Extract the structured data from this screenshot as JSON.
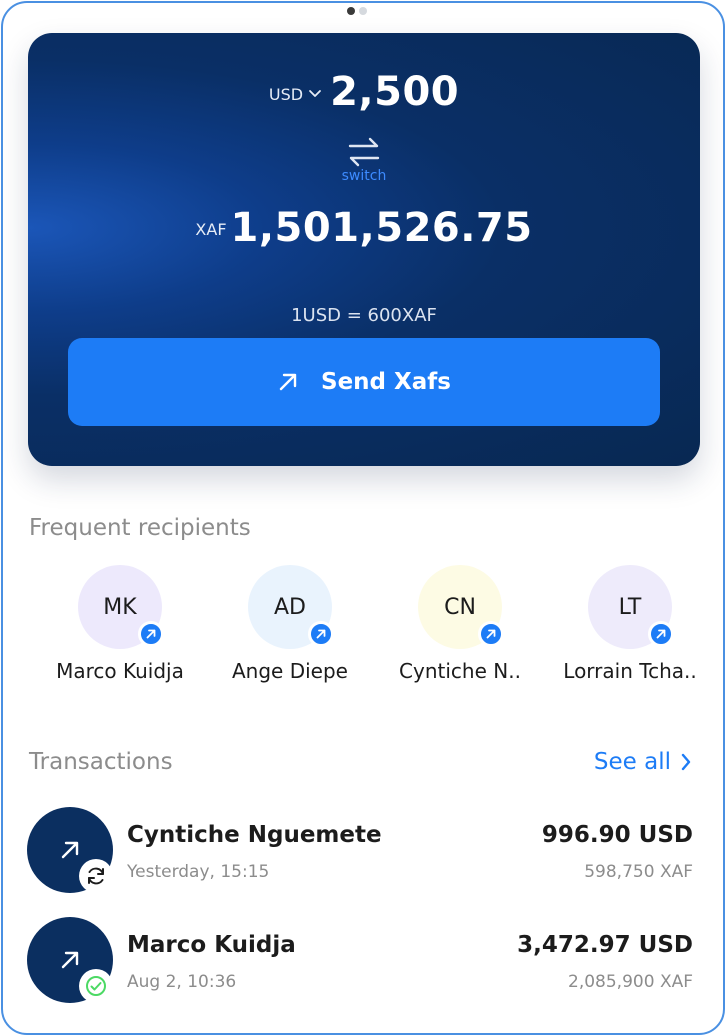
{
  "converter": {
    "from_currency": "USD",
    "from_amount": "2,500",
    "switch_label": "switch",
    "to_currency": "XAF",
    "to_amount": "1,501,526.75",
    "rate_text": "1USD = 600XAF",
    "send_label": "Send Xafs"
  },
  "recipients": {
    "title": "Frequent recipients",
    "items": [
      {
        "initials": "MK",
        "name": "Marco Kuidja",
        "bg": "#ede9fc"
      },
      {
        "initials": "AD",
        "name": "Ange Diepe",
        "bg": "#e9f3fd"
      },
      {
        "initials": "CN",
        "name": "Cyntiche N..",
        "bg": "#fdfbe4"
      },
      {
        "initials": "LT",
        "name": "Lorrain Tcha..",
        "bg": "#eeebfb"
      }
    ]
  },
  "transactions": {
    "title": "Transactions",
    "see_all": "See all",
    "items": [
      {
        "name": "Cyntiche Nguemete",
        "date": "Yesterday, 15:15",
        "amount": "996.90 USD",
        "converted": "598,750 XAF",
        "status": "pending"
      },
      {
        "name": "Marco Kuidja",
        "date": "Aug 2, 10:36",
        "amount": "3,472.97 USD",
        "converted": "2,085,900 XAF",
        "status": "completed"
      }
    ]
  },
  "colors": {
    "accent": "#1d7cf6",
    "card_dark": "#082852",
    "success": "#4cd964"
  }
}
